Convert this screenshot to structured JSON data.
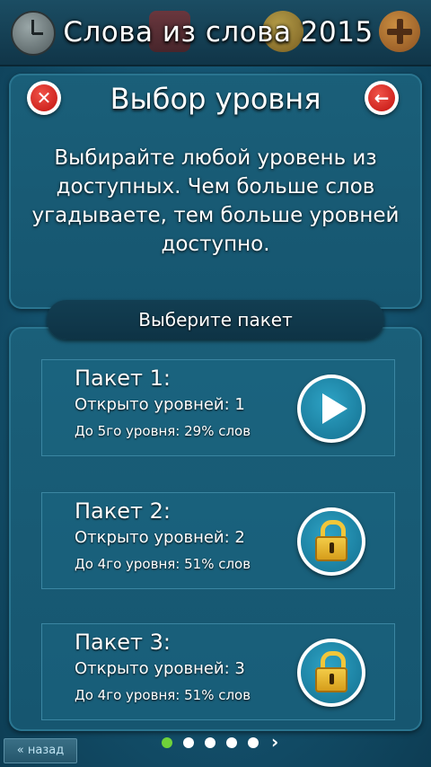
{
  "header": {
    "title": "Слова из слова 2015",
    "icons": [
      "clock-icon",
      "gift-icon",
      "coin-icon",
      "add-icon"
    ]
  },
  "level_select": {
    "title": "Выбор уровня",
    "description": "Выбирайте любой уровень из доступных. Чем больше слов угадываете, тем больше уровней доступно.",
    "select_pack_label": "Выберите пакет"
  },
  "packs": [
    {
      "title": "Пакет 1:",
      "opened": "Открыто уровней: 1",
      "progress": "До 5го уровня: 29% слов",
      "action": "play"
    },
    {
      "title": "Пакет 2:",
      "opened": "Открыто уровней: 2",
      "progress": "До 4го уровня: 51% слов",
      "action": "locked"
    },
    {
      "title": "Пакет 3:",
      "opened": "Открыто уровней: 3",
      "progress": "До 4го уровня: 51% слов",
      "action": "locked"
    }
  ],
  "pager": {
    "total": 5,
    "active": 1,
    "next_symbol": "›"
  },
  "footer": {
    "back_label": "« назад"
  },
  "colors": {
    "background": "#155673",
    "close": "#d8211c",
    "active_dot": "#6fd23a",
    "lock": "#f1c63a"
  }
}
